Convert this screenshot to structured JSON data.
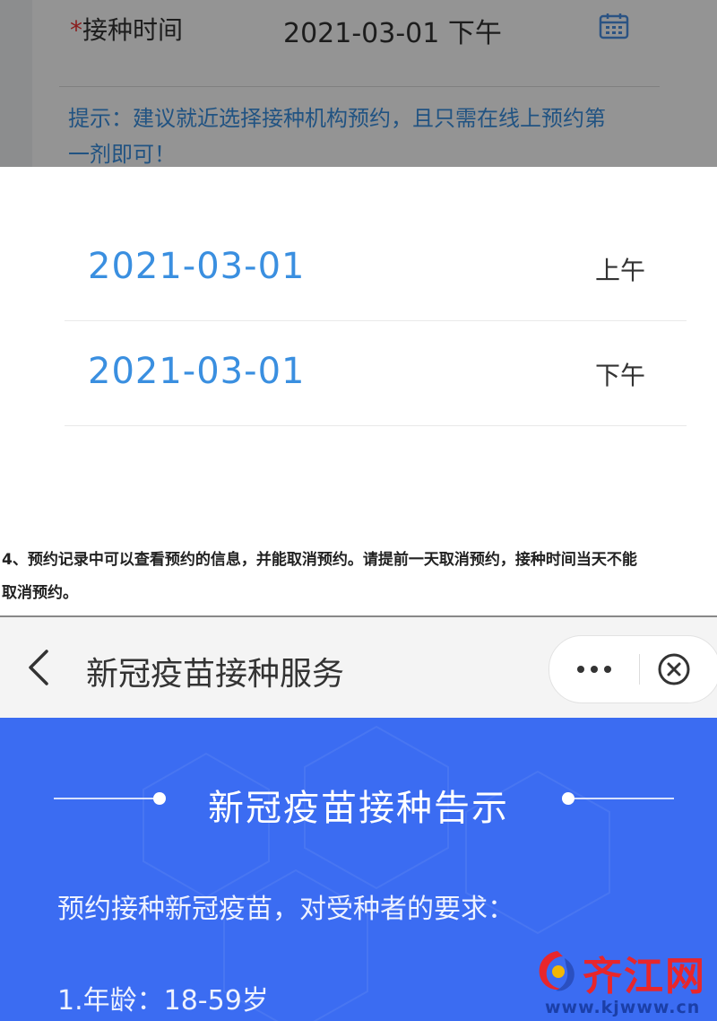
{
  "form": {
    "required_mark": "*",
    "vaccination_time_label": "接种时间",
    "vaccination_time_value": "2021-03-01 下午",
    "tip": "提示：建议就近选择接种机构预约，且只需在线上预约第一剂即可！"
  },
  "picker": {
    "options": [
      {
        "date": "2021-03-01",
        "period": "上午"
      },
      {
        "date": "2021-03-01",
        "period": "下午"
      }
    ]
  },
  "caption": {
    "line1": "4、预约记录中可以查看预约的信息，并能取消预约。请提前一天取消预约，接种时间当天不能",
    "line2": "取消预约。"
  },
  "navbar": {
    "title": "新冠疫苗接种服务"
  },
  "notice": {
    "title": "新冠疫苗接种告示",
    "intro": "预约接种新冠疫苗，对受种者的要求：",
    "age_item": "1.年龄：18-59岁"
  },
  "watermark": {
    "brand": "齐江网",
    "url": "www.kjwww.cn"
  },
  "colors": {
    "accent_blue": "#3a8fe0",
    "hero_blue": "#3b6cf2",
    "required_red": "#e33333",
    "watermark_red": "#e8262b"
  }
}
